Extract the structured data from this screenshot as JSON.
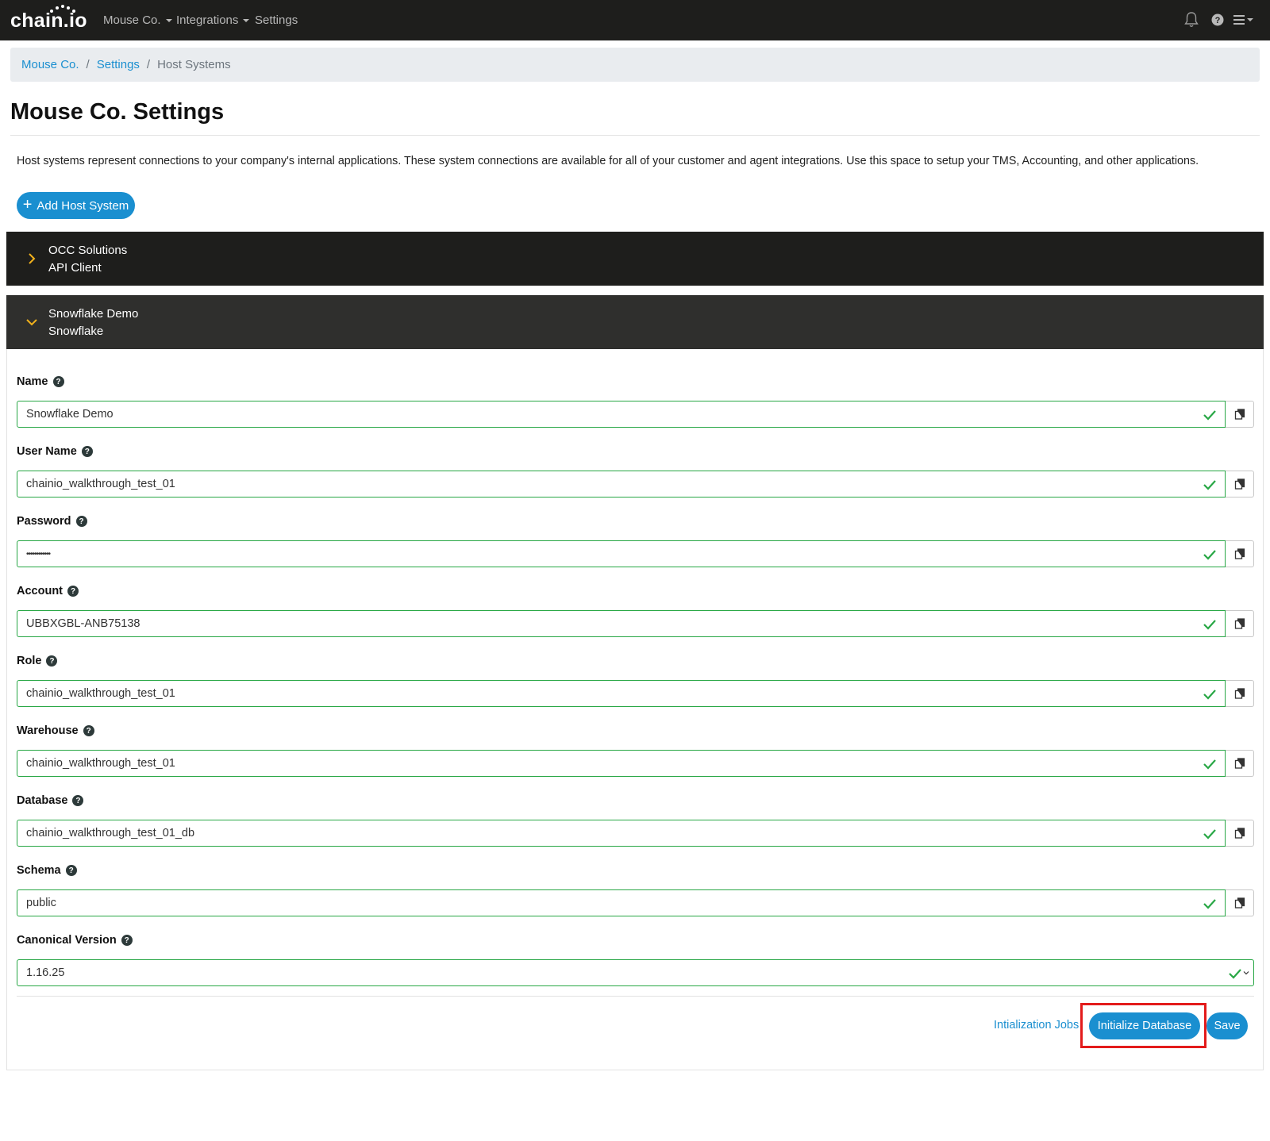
{
  "brand": {
    "logo_text": "chain.io"
  },
  "nav": {
    "items": [
      {
        "label": "Mouse Co.",
        "dropdown": true
      },
      {
        "label": "Integrations",
        "dropdown": true
      },
      {
        "label": "Settings",
        "dropdown": false
      }
    ],
    "icons": [
      "bell-icon",
      "help-icon",
      "hamburger-menu-icon"
    ]
  },
  "breadcrumb": {
    "items": [
      "Mouse Co.",
      "Settings",
      "Host Systems"
    ],
    "separator": "/"
  },
  "page": {
    "title": "Mouse Co. Settings",
    "description": "Host systems represent connections to your company's internal applications. These system connections are available for all of your customer and agent integrations. Use this space to setup your TMS, Accounting, and other applications.",
    "add_button_label": "Add Host System",
    "add_button_icon": "+"
  },
  "host_systems": [
    {
      "name": "OCC Solutions",
      "type": "API Client",
      "expanded": false
    },
    {
      "name": "Snowflake Demo",
      "type": "Snowflake",
      "expanded": true
    }
  ],
  "form": {
    "fields": [
      {
        "label": "Name",
        "value": "Snowflake Demo"
      },
      {
        "label": "User Name",
        "value": "chainio_walkthrough_test_01"
      },
      {
        "label": "Password",
        "value": "••••••••••••"
      },
      {
        "label": "Account",
        "value": "UBBXGBL-ANB75138"
      },
      {
        "label": "Role",
        "value": "chainio_walkthrough_test_01"
      },
      {
        "label": "Warehouse",
        "value": "chainio_walkthrough_test_01"
      },
      {
        "label": "Database",
        "value": "chainio_walkthrough_test_01_db"
      },
      {
        "label": "Schema",
        "value": "public"
      }
    ],
    "canonical_version": {
      "label": "Canonical Version",
      "value": "1.16.25"
    },
    "help_glyph": "?",
    "initialization_jobs_link": "Intialization Jobs",
    "initialize_database_label": "Initialize Database",
    "save_label": "Save"
  },
  "colors": {
    "navbar": "#1e1e1c",
    "accent": "#1a8fd0",
    "valid": "#28a745",
    "chevron": "#f2b21c",
    "highlight": "#e31b1b"
  }
}
